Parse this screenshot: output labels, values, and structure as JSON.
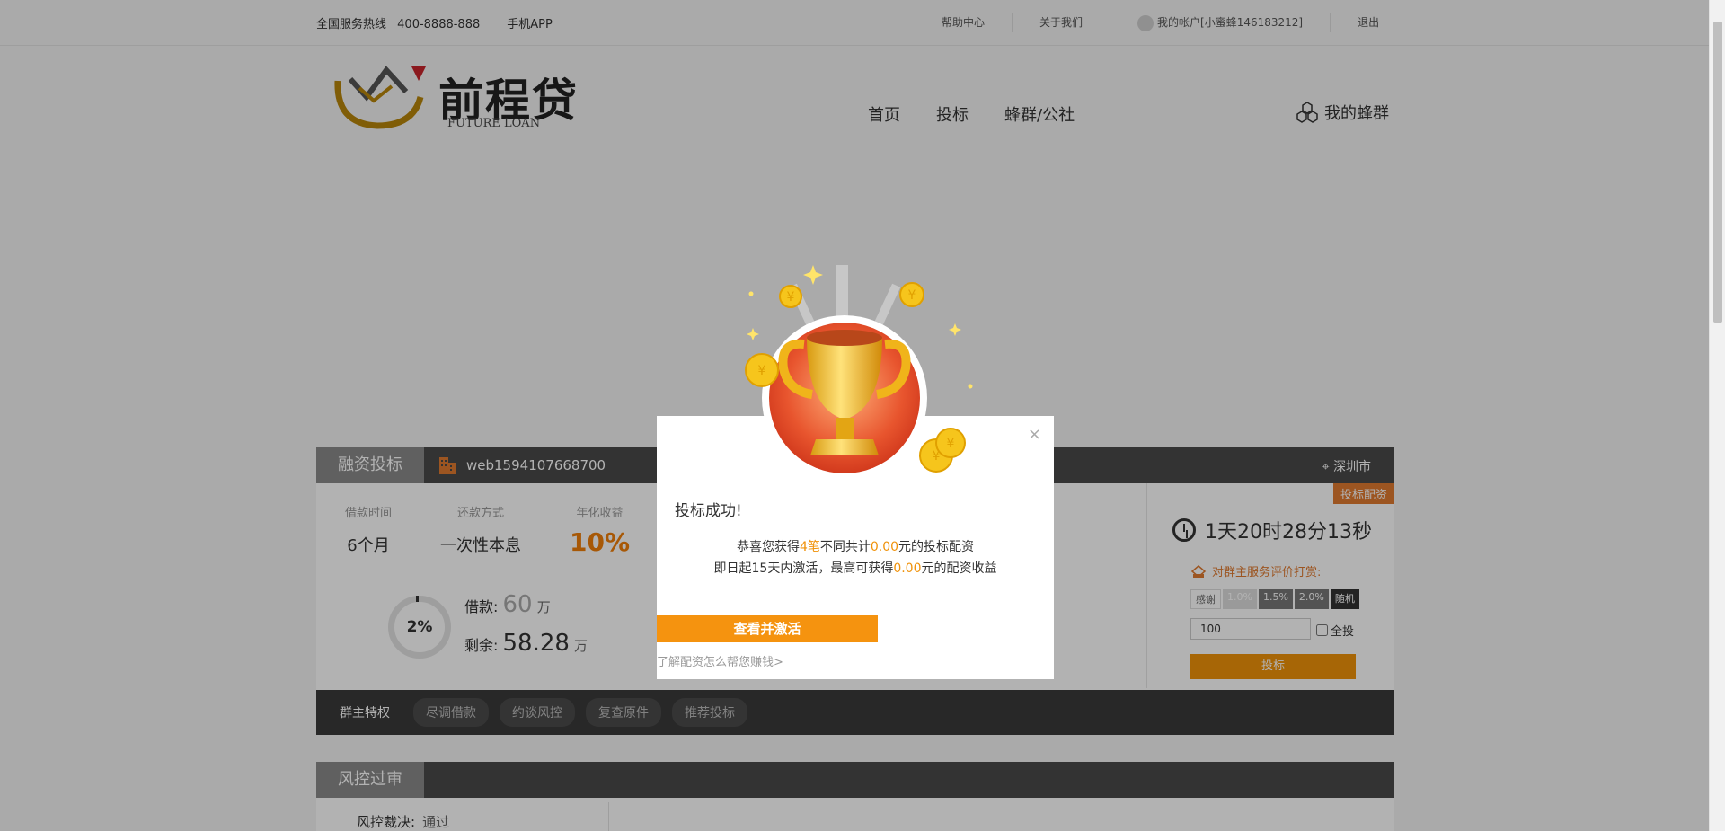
{
  "topbar": {
    "hotline_label": "全国服务热线",
    "hotline_number": "400-8888-888",
    "app_label": "手机APP",
    "help_label": "帮助中心",
    "about_label": "关于我们",
    "account_label": "我的帐户[小蜜蜂146183212]",
    "logout_label": "退出"
  },
  "header": {
    "brand": "前程贷",
    "brand_sub": "FUTURE LOAN",
    "nav": [
      "首页",
      "投标",
      "蜂群/公社"
    ],
    "mybee_label": "我的蜂群"
  },
  "product": {
    "tab_label": "融资投标",
    "username": "web1594107668700",
    "city": "深圳市",
    "stats": [
      {
        "label": "借款时间",
        "value": "6个月"
      },
      {
        "label": "还款方式",
        "value": "一次性本息"
      },
      {
        "label": "年化收益",
        "value": "10%"
      }
    ],
    "progress_text": "2%",
    "progress_value": 0.02,
    "loan_label": "借款:",
    "loan_amount": "60",
    "loan_unit": "万",
    "remain_label": "剩余:",
    "remain_amount": "58.28",
    "remain_unit": "万",
    "config_tag": "投标配资",
    "countdown": "1天20时28分13秒",
    "rate_label": "对群主服务评价打赏:",
    "rate_options": [
      "感谢",
      "1.0%",
      "1.5%",
      "2.0%",
      "随机"
    ],
    "amount_value": "100",
    "all_label": "全投",
    "invest_label": "投标",
    "tabs": [
      "群主特权",
      "尽调借款",
      "约谈风控",
      "复查原件",
      "推荐投标"
    ]
  },
  "risk": {
    "tab_label": "风控过审",
    "decision_label": "风控裁决:",
    "decision_value": "通过"
  },
  "modal": {
    "title": "投标成功!",
    "line1_prefix": "恭喜您获得",
    "line1_count": "4笔",
    "line1_mid": "不同共计",
    "line1_amount": "0.00",
    "line1_suffix": "元的投标配资",
    "line2_prefix": "即日起15天内激活，最高可获得",
    "line2_amount": "0.00",
    "line2_suffix": "元的配资收益",
    "activate_label": "查看并激活",
    "learn_label": "了解配资怎么帮您赚钱>",
    "close_label": "×"
  },
  "colors": {
    "accent": "#f0920a",
    "header_dark": "#4a4a4a"
  }
}
